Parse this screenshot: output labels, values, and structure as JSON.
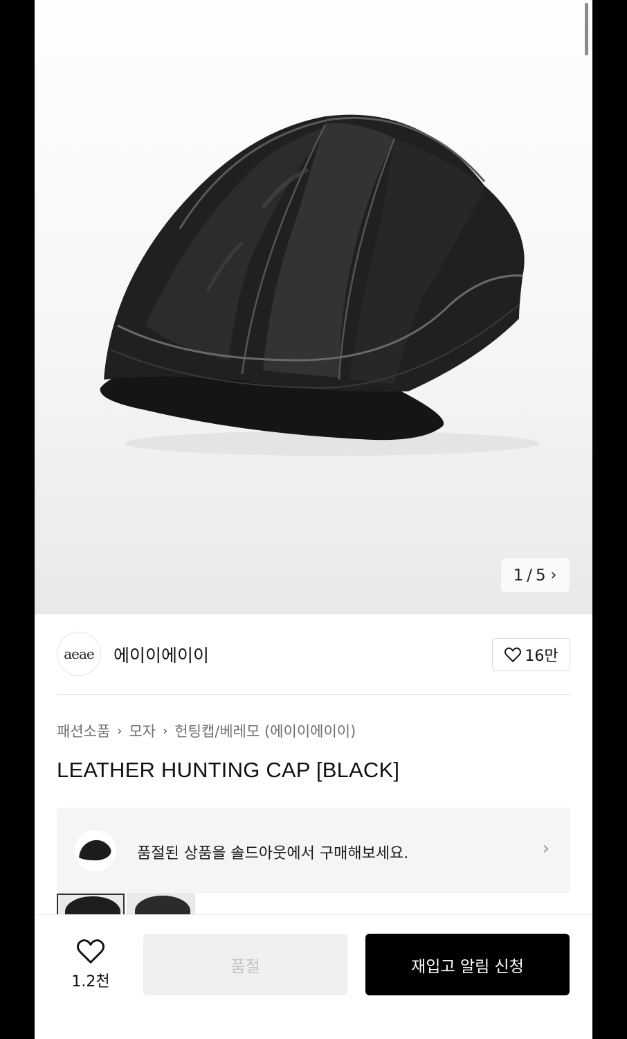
{
  "gallery": {
    "image_alt": "leather hunting cap",
    "pager_current": "1",
    "pager_total": "5",
    "pager_sep": "/",
    "pager_next_icon": "chevron-right-icon"
  },
  "brand": {
    "logo_text": "aeae",
    "name": "에이이에이이",
    "like_icon": "heart-outline-icon",
    "like_count": "16만"
  },
  "breadcrumb": {
    "items": [
      "패션소품",
      "모자",
      "헌팅캡/베레모 (에이이에이이)"
    ],
    "separator_icon": "chevron-right-icon"
  },
  "product": {
    "title": "LEATHER HUNTING CAP [BLACK]"
  },
  "soldout_banner": {
    "text": "품절된 상품을 솔드아웃에서 구매해보세요.",
    "chevron_icon": "chevron-right-icon"
  },
  "thumbnails": {
    "count": 2
  },
  "bottom_bar": {
    "wish_icon": "heart-outline-icon",
    "wish_count": "1.2천",
    "soldout_label": "품절",
    "restock_label": "재입고 알림 신청"
  },
  "colors": {
    "primary": "#000000",
    "disabled_bg": "#f0f0f0",
    "disabled_text": "#c3c3c3",
    "banner_bg": "#f5f5f5"
  }
}
